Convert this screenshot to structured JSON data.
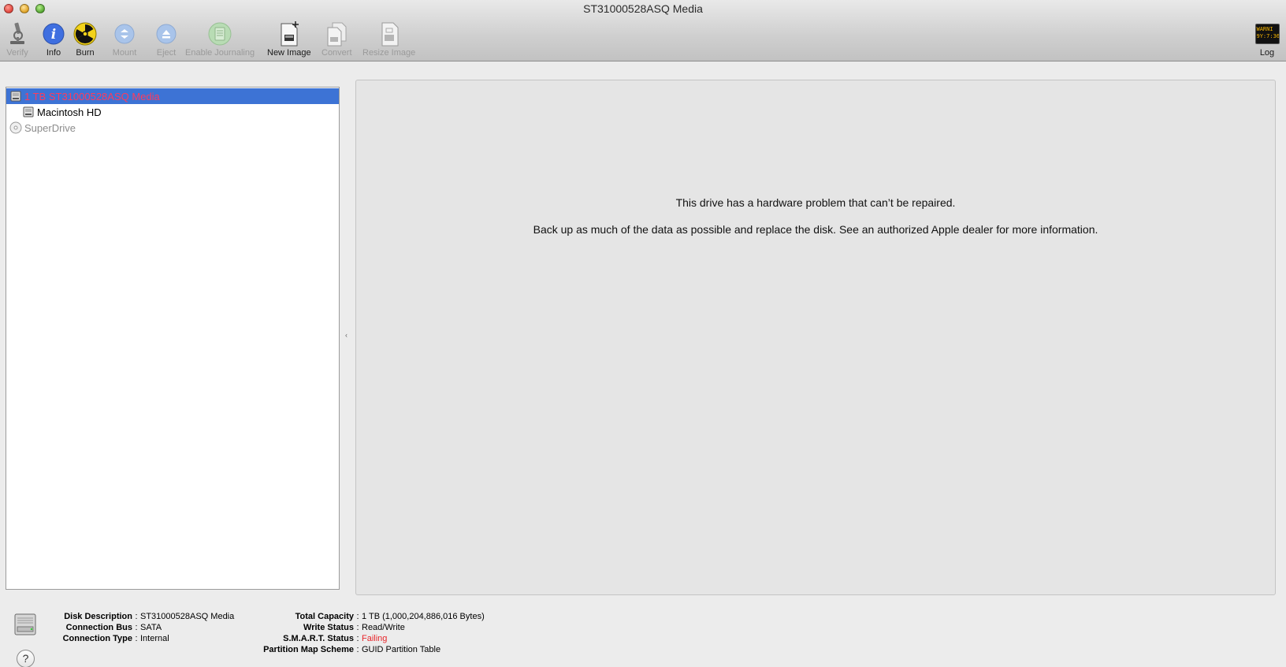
{
  "window": {
    "title": "ST31000528ASQ Media"
  },
  "toolbar": {
    "verify": "Verify",
    "info": "Info",
    "burn": "Burn",
    "mount": "Mount",
    "eject": "Eject",
    "enable_journaling": "Enable Journaling",
    "new_image": "New Image",
    "convert": "Convert",
    "resize_image": "Resize Image",
    "log": "Log",
    "log_icon_text_1": "WARNI",
    "log_icon_text_2": "9Y:7:36"
  },
  "sidebar": {
    "items": [
      {
        "label": "1 TB ST31000528ASQ Media",
        "icon": "hard-drive-icon",
        "selected": true
      },
      {
        "label": "Macintosh HD",
        "icon": "volume-icon",
        "selected": false
      },
      {
        "label": "SuperDrive",
        "icon": "optical-drive-icon",
        "selected": false,
        "dimmed": true
      }
    ]
  },
  "main": {
    "message_line1": "This drive has a hardware problem that can’t be repaired.",
    "message_line2": "Back up as much of the data as possible and replace the disk. See an authorized Apple dealer for more information."
  },
  "info": {
    "disk_description_label": "Disk Description",
    "disk_description_value": "ST31000528ASQ Media",
    "connection_bus_label": "Connection Bus",
    "connection_bus_value": "SATA",
    "connection_type_label": "Connection Type",
    "connection_type_value": "Internal",
    "total_capacity_label": "Total Capacity",
    "total_capacity_value": "1 TB (1,000,204,886,016 Bytes)",
    "write_status_label": "Write Status",
    "write_status_value": "Read/Write",
    "smart_status_label": "S.M.A.R.T. Status",
    "smart_status_value": "Failing",
    "partition_map_label": "Partition Map Scheme",
    "partition_map_value": "GUID Partition Table",
    "separator": ":",
    "help_glyph": "?"
  },
  "colors": {
    "selection": "#3d73d5",
    "selected_text": "#ff3b5c",
    "failing": "#e8262b"
  }
}
